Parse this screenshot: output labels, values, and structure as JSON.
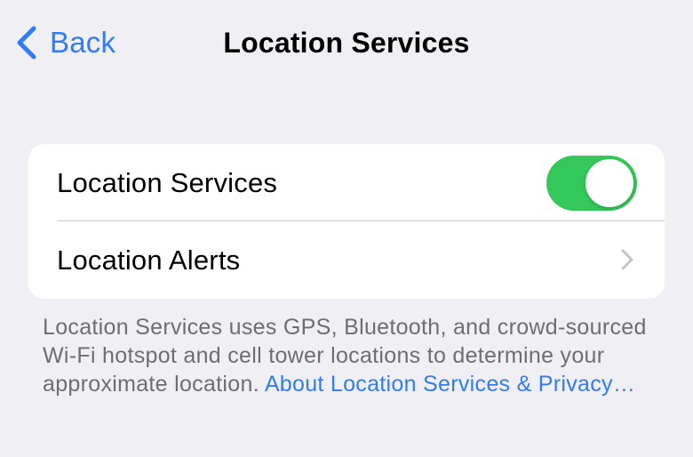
{
  "nav": {
    "back_label": "Back",
    "title": "Location Services"
  },
  "settings": {
    "rows": [
      {
        "label": "Location Services",
        "toggle_on": true
      },
      {
        "label": "Location Alerts"
      }
    ]
  },
  "footer": {
    "text": "Location Services uses GPS, Bluetooth, and crowd-sourced Wi-Fi hotspot and cell tower locations to determine your approximate location. ",
    "link": "About Location Services & Privacy…"
  },
  "colors": {
    "background": "#efeff4",
    "accent_blue": "#2f7cf6",
    "toggle_green": "#34c759",
    "secondary_text": "#6d6d72"
  },
  "icons": {
    "back": "chevron-left-icon",
    "disclosure": "chevron-right-icon"
  }
}
